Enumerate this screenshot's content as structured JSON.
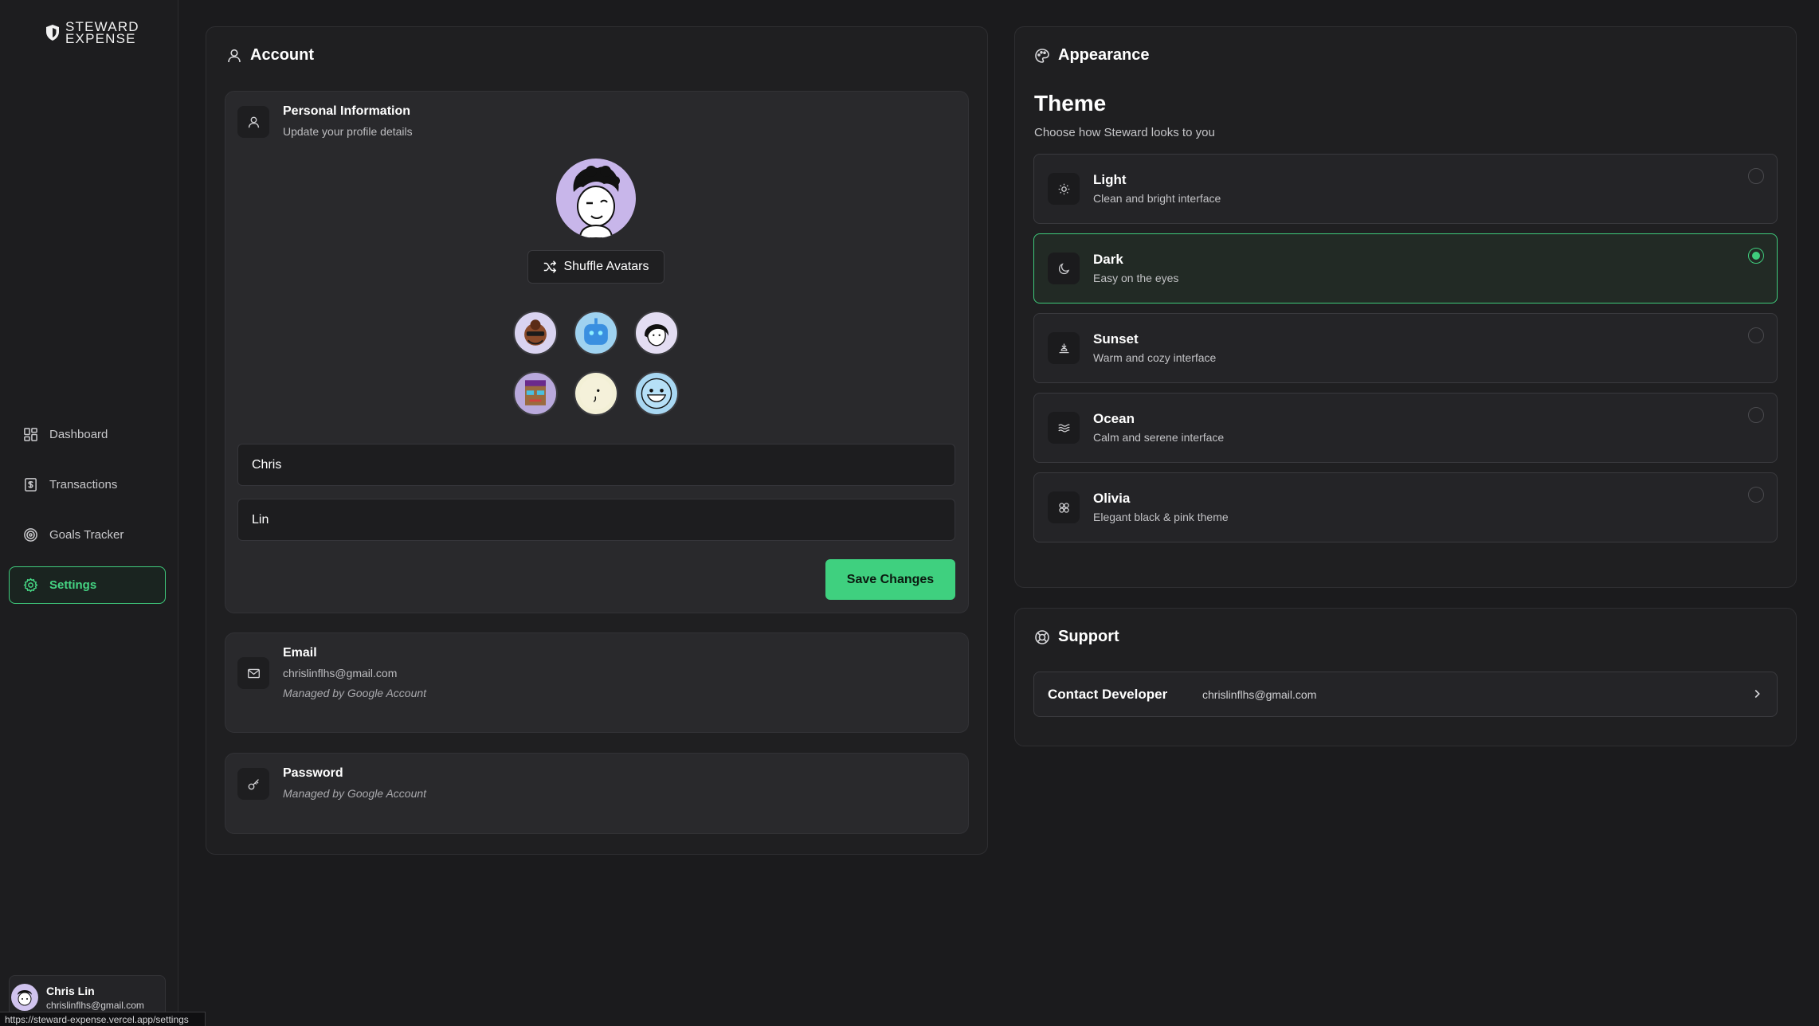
{
  "brand": {
    "line1": "STEWARD",
    "line2": "EXPENSE"
  },
  "sidebar": {
    "items": [
      {
        "label": "Dashboard",
        "icon": "dashboard-icon"
      },
      {
        "label": "Transactions",
        "icon": "receipt-icon"
      },
      {
        "label": "Goals Tracker",
        "icon": "target-icon"
      },
      {
        "label": "Settings",
        "icon": "gear-icon",
        "active": true
      }
    ]
  },
  "user": {
    "name": "Chris Lin",
    "email": "chrislinflhs@gmail.com"
  },
  "status_url": "https://steward-expense.vercel.app/settings",
  "account": {
    "title": "Account",
    "personal": {
      "title": "Personal Information",
      "subtitle": "Update your profile details",
      "shuffle_label": "Shuffle Avatars",
      "first_name": "Chris",
      "last_name": "Lin",
      "save_label": "Save Changes"
    },
    "email": {
      "title": "Email",
      "value": "chrislinflhs@gmail.com",
      "note": "Managed by Google Account"
    },
    "password": {
      "title": "Password",
      "note": "Managed by Google Account"
    }
  },
  "appearance": {
    "title": "Appearance",
    "theme_heading": "Theme",
    "theme_description": "Choose how Steward looks to you",
    "themes": [
      {
        "name": "Light",
        "description": "Clean and bright interface",
        "icon": "sun-icon"
      },
      {
        "name": "Dark",
        "description": "Easy on the eyes",
        "icon": "moon-icon",
        "selected": true
      },
      {
        "name": "Sunset",
        "description": "Warm and cozy interface",
        "icon": "sunset-icon"
      },
      {
        "name": "Ocean",
        "description": "Calm and serene interface",
        "icon": "waves-icon"
      },
      {
        "name": "Olivia",
        "description": "Elegant black & pink theme",
        "icon": "flower-icon"
      }
    ]
  },
  "support": {
    "title": "Support",
    "contact_label": "Contact Developer",
    "contact_email": "chrislinflhs@gmail.com"
  },
  "colors": {
    "accent": "#3fcb7c",
    "background": "#1b1b1d",
    "panel": "#1f1f21",
    "card": "#29292c"
  }
}
